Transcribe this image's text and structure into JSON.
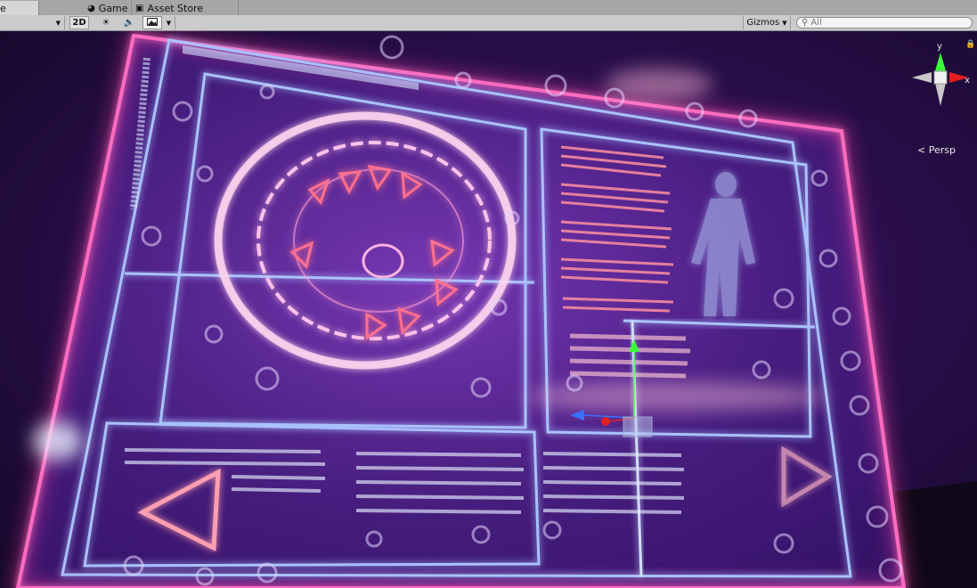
{
  "tabs": [
    {
      "label": "e"
    },
    {
      "label": "Game"
    },
    {
      "label": "Asset Store"
    }
  ],
  "toolbar": {
    "mode_2d": "2D",
    "gizmos_label": "Gizmos",
    "search_placeholder": "All"
  },
  "gizmo": {
    "y_label": "y",
    "x_label": "x",
    "projection_label": "Persp"
  },
  "colors": {
    "neon_pink": "#ff3fa6",
    "neon_blue": "#9fb8ff",
    "axis_y": "#3cff3c",
    "axis_x": "#e21e1e",
    "axis_z": "#3a6fff"
  },
  "icons": {
    "scene_tab": "hash-icon",
    "game_tab": "pacman-icon",
    "asset_tab": "bag-icon",
    "lighting": "sun-icon",
    "audio": "speaker-icon",
    "effects": "image-icon",
    "search": "magnifier-icon",
    "lock": "lock-icon"
  }
}
